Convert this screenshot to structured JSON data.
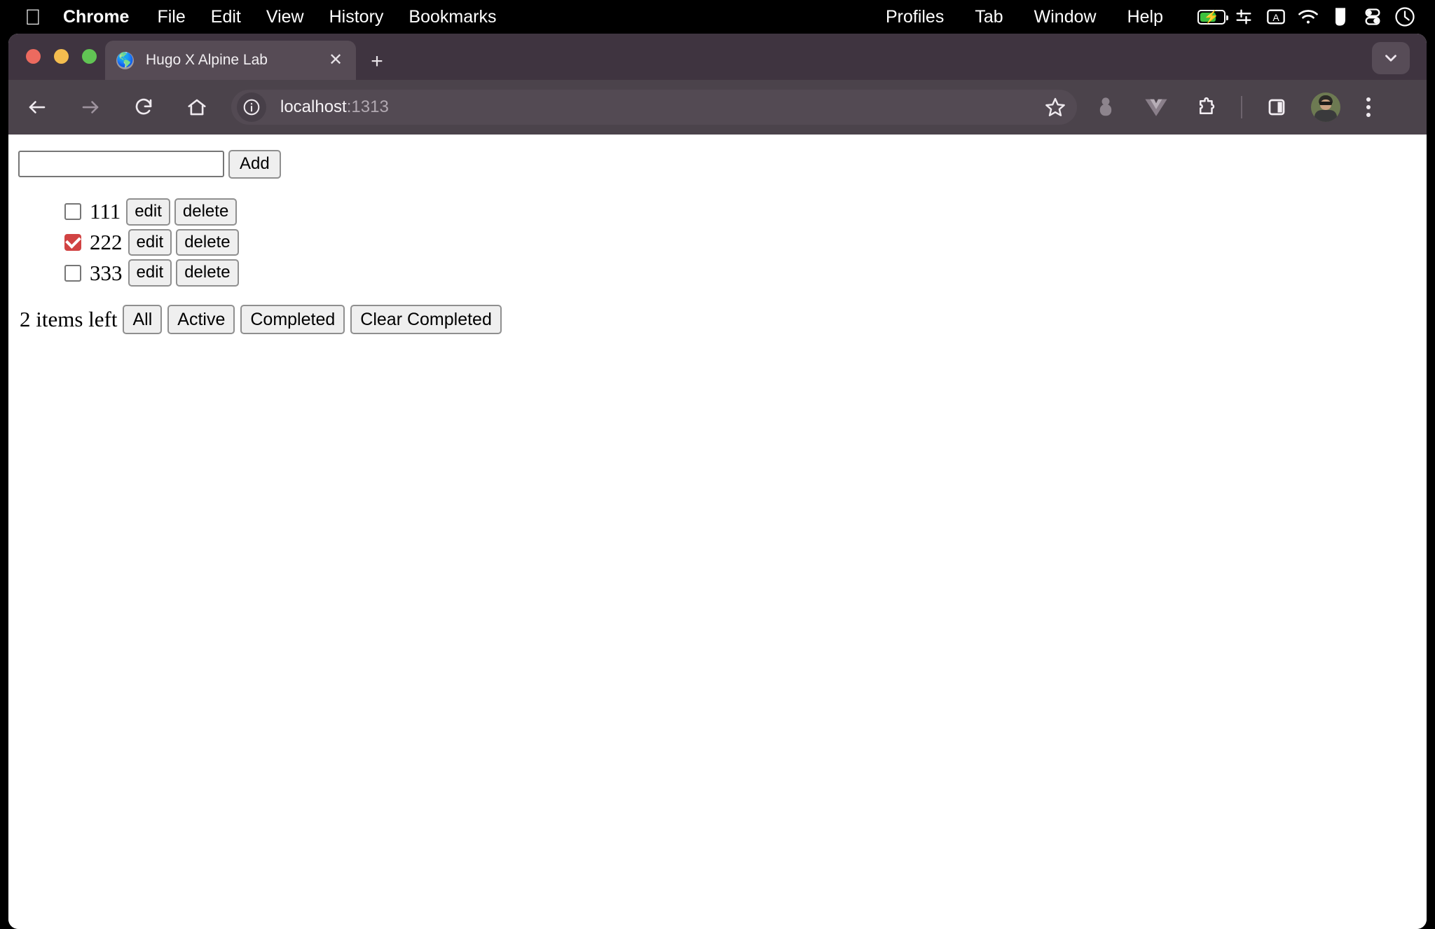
{
  "menubar": {
    "apple_icon": "apple-logo",
    "items": [
      {
        "label": "Chrome",
        "bold": true
      },
      {
        "label": "File",
        "bold": false
      },
      {
        "label": "Edit",
        "bold": false
      },
      {
        "label": "View",
        "bold": false
      },
      {
        "label": "History",
        "bold": false
      },
      {
        "label": "Bookmarks",
        "bold": false
      }
    ],
    "right_items": [
      {
        "label": "Profiles"
      },
      {
        "label": "Tab"
      },
      {
        "label": "Window"
      },
      {
        "label": "Help"
      }
    ],
    "status_icons": [
      "battery-charging-icon",
      "control-center-icon",
      "keyboard-input-a-icon",
      "wifi-icon",
      "shape-icon",
      "toggle-switch-icon",
      "clock-icon"
    ],
    "battery_color": "#3ec13e"
  },
  "browser": {
    "tab": {
      "title": "Hugo X Alpine Lab",
      "favicon": "globe-icon",
      "close_icon": "close-icon"
    },
    "new_tab_icon": "plus-icon",
    "tab_search_icon": "chevron-down-icon",
    "traffic_lights": [
      "close-red",
      "minimize-yellow",
      "maximize-green"
    ],
    "toolbar": {
      "back_icon": "arrow-left-icon",
      "forward_icon": "arrow-right-icon",
      "reload_icon": "reload-icon",
      "home_icon": "home-icon",
      "site_info_icon": "info-circle-icon",
      "url_host": "localhost",
      "url_port": ":1313",
      "bookmark_icon": "star-icon",
      "extension_icons": [
        "gray-pill-icon",
        "vue-devtools-icon",
        "puzzle-piece-icon"
      ],
      "side_panel_icon": "side-panel-icon",
      "avatar": "profile-avatar",
      "menu_icon": "three-dots-vertical-icon"
    },
    "colors": {
      "tabstrip_bg": "#3f3440",
      "active_tab_bg": "#564b55",
      "toolbar_bg": "#4b434b",
      "omnibox_bg": "#534a53",
      "page_bg": "#ffffff"
    }
  },
  "page": {
    "add_form": {
      "input_value": "",
      "input_placeholder": "",
      "add_label": "Add"
    },
    "todos": [
      {
        "label": "111",
        "checked": false,
        "edit_label": "edit",
        "delete_label": "delete"
      },
      {
        "label": "222",
        "checked": true,
        "edit_label": "edit",
        "delete_label": "delete"
      },
      {
        "label": "333",
        "checked": false,
        "edit_label": "edit",
        "delete_label": "delete"
      }
    ],
    "footer": {
      "items_left": "2 items left",
      "filters": [
        {
          "label": "All"
        },
        {
          "label": "Active"
        },
        {
          "label": "Completed"
        }
      ],
      "clear_label": "Clear Completed"
    },
    "checked_color": "#d14343"
  }
}
